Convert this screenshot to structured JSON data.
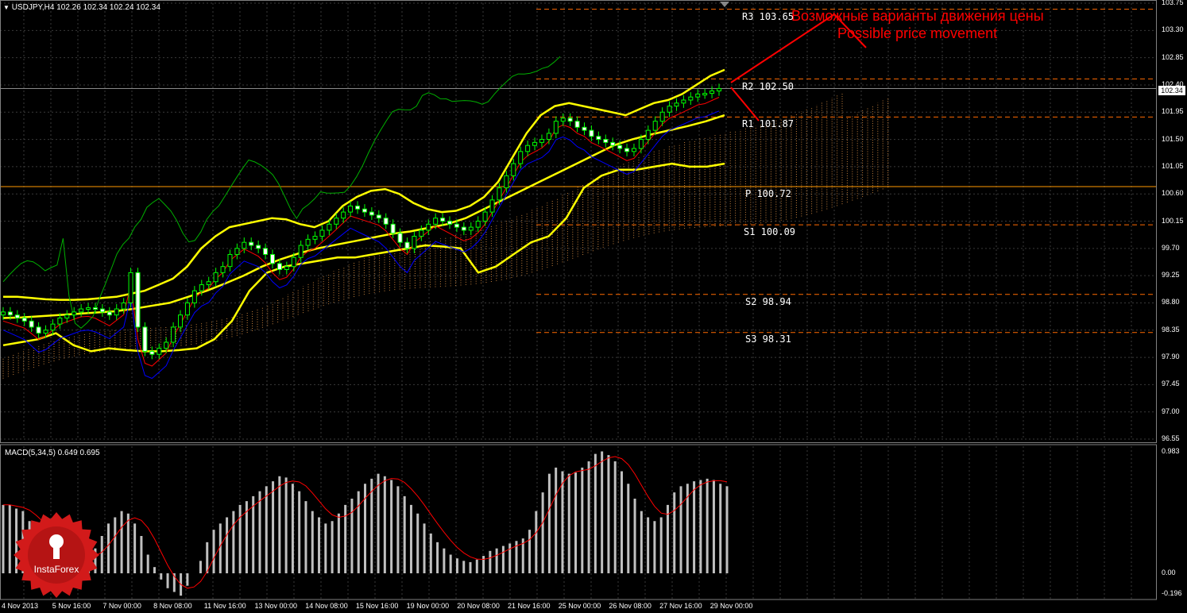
{
  "header": {
    "symbol_line": "USDJPY,H4  102.26 102.34 102.24 102.34",
    "macd_line": "MACD(5,34,5) 0.649 0.695"
  },
  "current_price_tag": "102.34",
  "annotations": {
    "ru": "Возможные варианты движения цены",
    "en": "Possible price movement"
  },
  "levels": [
    {
      "label": "R3  103.65",
      "value": 103.65
    },
    {
      "label": "R2  102.50",
      "value": 102.5
    },
    {
      "label": "R1  101.87",
      "value": 101.87
    },
    {
      "label": "P  100.72",
      "value": 100.72
    },
    {
      "label": "S1  100.09",
      "value": 100.09
    },
    {
      "label": "S2  98.94",
      "value": 98.94
    },
    {
      "label": "S3  98.31",
      "value": 98.31
    }
  ],
  "colors": {
    "background": "#000000",
    "grid": "#3a3a3a",
    "bollinger": "#ffff00",
    "level_line": "#ff6a00",
    "pivot_line": "#ff9900",
    "tenkan": "#ff0000",
    "kijun": "#0000ff",
    "chikou": "#00b000",
    "macd_hist": "#c0c0c0",
    "macd_signal": "#ff0000",
    "annotation": "#ff0000",
    "logo": "#d21a1a"
  },
  "logo": {
    "text": "InstaForex",
    "icon": "instaforex-logo-icon"
  },
  "chart_data": [
    {
      "type": "candlestick",
      "title": "USDJPY,H4",
      "ylim": [
        96.55,
        103.75
      ],
      "y_ticks": [
        "103.75",
        "103.30",
        "102.85",
        "102.40",
        "101.95",
        "101.50",
        "101.05",
        "100.60",
        "100.15",
        "99.70",
        "99.25",
        "98.80",
        "98.35",
        "97.90",
        "97.45",
        "97.00",
        "96.55"
      ],
      "x_ticks": [
        "4 Nov 2013",
        "5 Nov 16:00",
        "7 Nov 00:00",
        "8 Nov 08:00",
        "11 Nov 16:00",
        "13 Nov 00:00",
        "14 Nov 08:00",
        "15 Nov 16:00",
        "19 Nov 00:00",
        "20 Nov 08:00",
        "21 Nov 16:00",
        "25 Nov 00:00",
        "26 Nov 08:00",
        "27 Nov 16:00",
        "29 Nov 00:00"
      ],
      "close_series": [
        98.65,
        98.6,
        98.55,
        98.5,
        98.4,
        98.3,
        98.35,
        98.45,
        98.55,
        98.6,
        98.65,
        98.7,
        98.72,
        98.7,
        98.65,
        98.6,
        98.7,
        98.8,
        99.3,
        98.4,
        98.0,
        97.95,
        98.05,
        98.15,
        98.4,
        98.6,
        98.8,
        99.0,
        99.1,
        99.15,
        99.3,
        99.4,
        99.6,
        99.7,
        99.8,
        99.75,
        99.7,
        99.6,
        99.45,
        99.35,
        99.4,
        99.55,
        99.75,
        99.85,
        99.9,
        100.0,
        100.1,
        100.2,
        100.3,
        100.4,
        100.35,
        100.3,
        100.25,
        100.2,
        100.1,
        99.95,
        99.8,
        99.7,
        99.9,
        100.0,
        100.1,
        100.2,
        100.15,
        100.1,
        100.05,
        100.0,
        100.05,
        100.15,
        100.3,
        100.5,
        100.7,
        100.9,
        101.1,
        101.3,
        101.4,
        101.45,
        101.5,
        101.6,
        101.8,
        101.85,
        101.8,
        101.7,
        101.65,
        101.55,
        101.5,
        101.45,
        101.4,
        101.35,
        101.3,
        101.35,
        101.5,
        101.65,
        101.8,
        101.95,
        102.05,
        102.1,
        102.15,
        102.2,
        102.25,
        102.26,
        102.3,
        102.34
      ],
      "bollinger_upper": [
        98.9,
        98.9,
        98.88,
        98.86,
        98.85,
        98.85,
        98.86,
        98.88,
        98.9,
        98.95,
        99.0,
        99.1,
        99.2,
        99.4,
        99.7,
        99.9,
        100.05,
        100.1,
        100.15,
        100.2,
        100.18,
        100.1,
        100.05,
        100.15,
        100.4,
        100.55,
        100.65,
        100.68,
        100.6,
        100.45,
        100.35,
        100.3,
        100.32,
        100.4,
        100.55,
        100.8,
        101.2,
        101.6,
        101.9,
        102.05,
        102.1,
        102.05,
        102.0,
        101.95,
        101.9,
        102.0,
        102.1,
        102.15,
        102.25,
        102.4,
        102.55,
        102.65
      ],
      "bollinger_mid": [
        98.55,
        98.56,
        98.58,
        98.6,
        98.62,
        98.64,
        98.66,
        98.7,
        98.75,
        98.8,
        98.9,
        99.0,
        99.12,
        99.25,
        99.4,
        99.52,
        99.62,
        99.7,
        99.76,
        99.82,
        99.88,
        99.94,
        99.98,
        100.04,
        100.1,
        100.2,
        100.35,
        100.5,
        100.65,
        100.8,
        100.95,
        101.1,
        101.25,
        101.4,
        101.5,
        101.58,
        101.65,
        101.72,
        101.8,
        101.9
      ],
      "bollinger_lower": [
        98.1,
        98.15,
        98.2,
        98.3,
        98.1,
        98.0,
        98.05,
        98.02,
        98.0,
        98.0,
        98.02,
        98.05,
        98.2,
        98.5,
        99.0,
        99.3,
        99.4,
        99.45,
        99.5,
        99.55,
        99.55,
        99.6,
        99.65,
        99.7,
        99.75,
        99.73,
        99.7,
        99.3,
        99.4,
        99.6,
        99.8,
        99.9,
        100.2,
        100.7,
        100.9,
        101.0,
        101.0,
        101.05,
        101.1,
        101.05,
        101.05,
        101.1
      ],
      "series": [
        {
          "name": "Tenkan-sen"
        },
        {
          "name": "Kijun-sen"
        },
        {
          "name": "Chikou Span"
        },
        {
          "name": "Senkou Span A/B cloud"
        }
      ]
    },
    {
      "type": "bar",
      "title": "MACD(5,34,5)",
      "ylim": [
        -0.196,
        0.983
      ],
      "y_ticks": [
        "0.983",
        "0.00",
        "-0.196"
      ],
      "series": [
        {
          "name": "MACD",
          "values": [
            0.55,
            0.55,
            0.52,
            0.5,
            0.42,
            0.35,
            0.3,
            0.28,
            0.25,
            0.2,
            0.15,
            0.12,
            0.1,
            0.13,
            0.2,
            0.3,
            0.4,
            0.45,
            0.5,
            0.48,
            0.4,
            0.3,
            0.15,
            0.05,
            -0.05,
            -0.12,
            -0.15,
            -0.18,
            -0.1,
            0.0,
            0.1,
            0.25,
            0.35,
            0.4,
            0.45,
            0.5,
            0.55,
            0.58,
            0.62,
            0.66,
            0.7,
            0.74,
            0.78,
            0.77,
            0.72,
            0.66,
            0.58,
            0.5,
            0.45,
            0.4,
            0.42,
            0.48,
            0.55,
            0.6,
            0.66,
            0.72,
            0.76,
            0.8,
            0.78,
            0.75,
            0.7,
            0.62,
            0.55,
            0.48,
            0.4,
            0.32,
            0.25,
            0.2,
            0.15,
            0.12,
            0.1,
            0.09,
            0.11,
            0.14,
            0.18,
            0.2,
            0.22,
            0.24,
            0.26,
            0.28,
            0.35,
            0.5,
            0.65,
            0.8,
            0.85,
            0.82,
            0.8,
            0.81,
            0.85,
            0.9,
            0.96,
            0.98,
            0.95,
            0.9,
            0.82,
            0.72,
            0.6,
            0.5,
            0.45,
            0.42,
            0.45,
            0.55,
            0.65,
            0.7,
            0.72,
            0.74,
            0.75,
            0.76,
            0.75,
            0.72,
            0.7
          ]
        },
        {
          "name": "Signal"
        }
      ]
    }
  ]
}
